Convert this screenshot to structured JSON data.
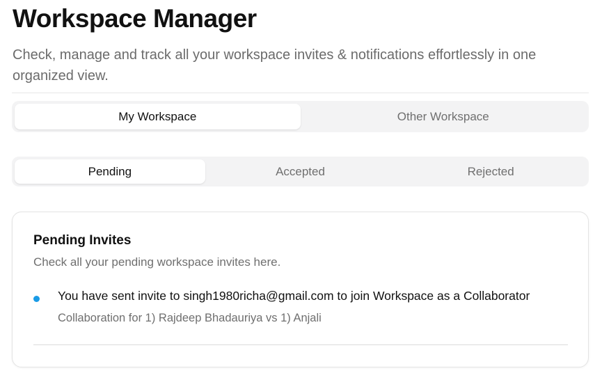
{
  "header": {
    "title": "Workspace Manager",
    "subtitle": "Check, manage and track all your workspace invites & notifications effortlessly in one organized view."
  },
  "workspace_tabs": {
    "selected": "My Workspace",
    "items": [
      {
        "label": "My Workspace"
      },
      {
        "label": "Other Workspace"
      }
    ]
  },
  "status_tabs": {
    "selected": "Pending",
    "items": [
      {
        "label": "Pending"
      },
      {
        "label": "Accepted"
      },
      {
        "label": "Rejected"
      }
    ]
  },
  "pending_card": {
    "title": "Pending Invites",
    "description": "Check all your pending workspace invites here.",
    "invites": [
      {
        "message": "You have sent invite to singh1980richa@gmail.com to join Workspace as a Collaborator",
        "detail": "Collaboration for 1) Rajdeep Bhadauriya vs 1) Anjali"
      }
    ]
  },
  "colors": {
    "bullet": "#1a9be6",
    "tab_track": "#f3f3f4",
    "tab_active": "#ffffff"
  }
}
